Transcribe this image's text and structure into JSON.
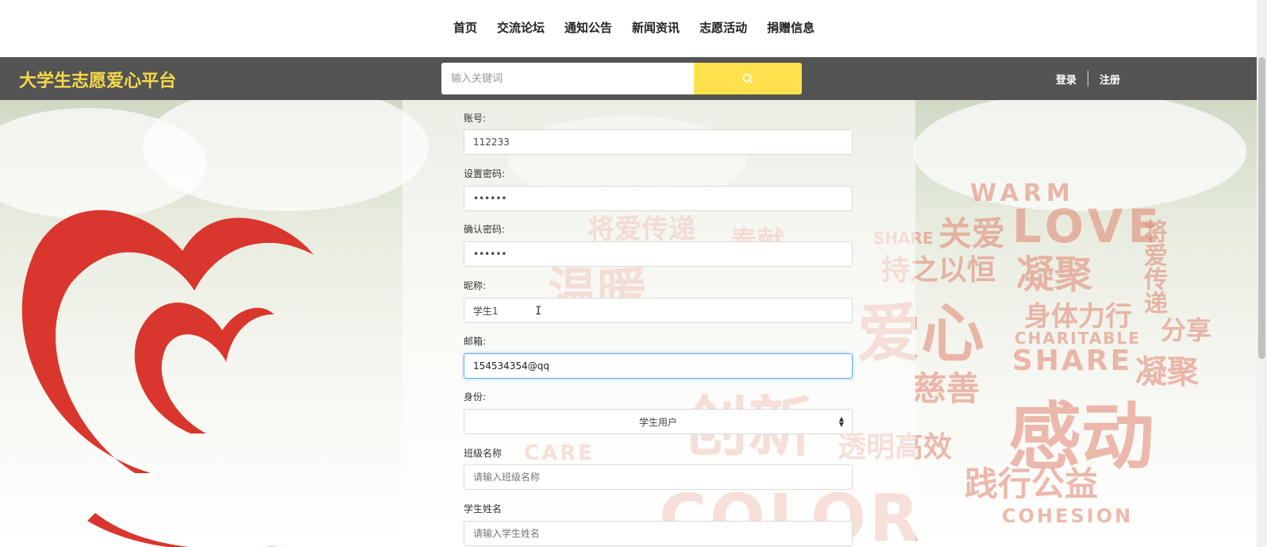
{
  "nav": {
    "items": [
      {
        "label": "首页"
      },
      {
        "label": "交流论坛"
      },
      {
        "label": "通知公告"
      },
      {
        "label": "新闻资讯"
      },
      {
        "label": "志愿活动"
      },
      {
        "label": "捐赠信息"
      }
    ]
  },
  "header": {
    "brand": "大学生志愿爱心平台",
    "search_placeholder": "输入关键词",
    "search_icon": "search-icon",
    "login_label": "登录",
    "register_label": "注册"
  },
  "colors": {
    "header_bg": "#545454",
    "brand": "#f5d84a",
    "search_button": "#ffe14d",
    "focus_border": "#66afe9"
  },
  "form": {
    "account": {
      "label": "账号:",
      "value": "112233"
    },
    "password": {
      "label": "设置密码:",
      "value": "••••••"
    },
    "confirm_password": {
      "label": "确认密码:",
      "value": "••••••"
    },
    "nickname": {
      "label": "昵称:",
      "value": "学生1"
    },
    "email": {
      "label": "邮箱:",
      "value": "154534354@qq"
    },
    "identity": {
      "label": "身份:",
      "selected": "学生用户"
    },
    "class_name": {
      "label": "班级名称",
      "placeholder": "请输入班级名称"
    },
    "student_name": {
      "label": "学生姓名",
      "placeholder": "请输入学生姓名"
    }
  },
  "background_words": [
    "WARM",
    "关爱",
    "LOVE",
    "将爱传递",
    "SHARE",
    "持之以恒",
    "凝聚",
    "爱心",
    "身体力行",
    "分享",
    "CHARITABLE",
    "慈善",
    "感动",
    "透明高效",
    "践行公益",
    "COHESION",
    "温暖",
    "创新",
    "CARE",
    "奉献",
    "COLOR"
  ]
}
